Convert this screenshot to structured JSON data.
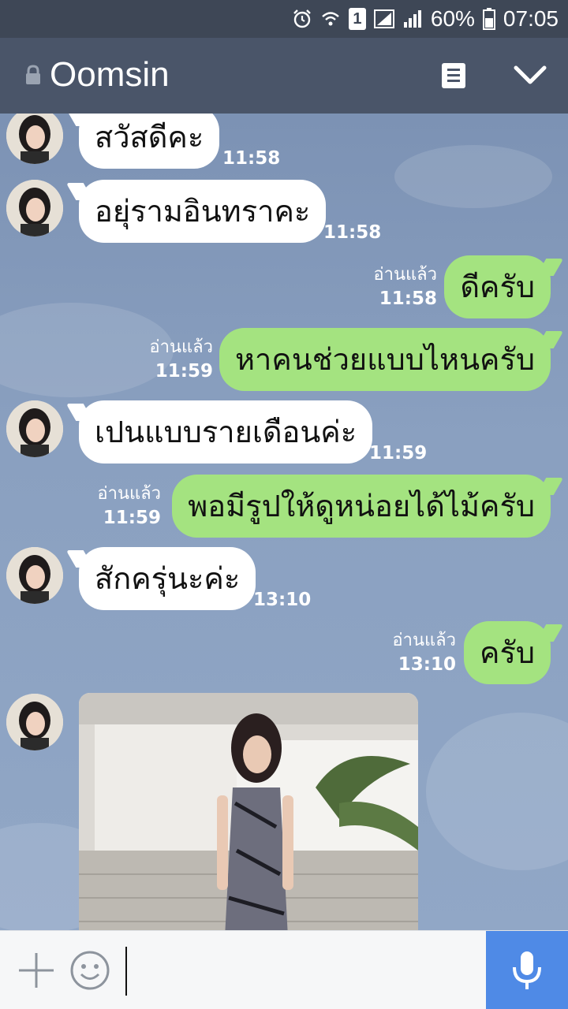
{
  "status_bar": {
    "battery": "60%",
    "time": "07:05",
    "sim_slot": "1",
    "icons": [
      "alarm-icon",
      "wifi-icon",
      "sim-icon",
      "signal-icon",
      "battery-icon"
    ]
  },
  "header": {
    "title": "Oomsin",
    "icons": [
      "lock-icon",
      "notes-icon",
      "chevron-down-icon"
    ]
  },
  "messages": [
    {
      "side": "in",
      "text": "สวัสดีคะ",
      "time": "11:58"
    },
    {
      "side": "in",
      "text": "อยุ่รามอินทราคะ",
      "time": "11:58"
    },
    {
      "side": "out",
      "text": "ดีครับ",
      "read": "อ่านแล้ว",
      "time": "11:58"
    },
    {
      "side": "out",
      "text": "หาคนช่วยแบบไหนครับ",
      "read": "อ่านแล้ว",
      "time": "11:59"
    },
    {
      "side": "in",
      "text": "เปนแบบรายเดือนค่ะ",
      "time": "11:59"
    },
    {
      "side": "out",
      "text": "พอมีรูปให้ดูหน่อยได้ไม้ครับ",
      "read": "อ่านแล้ว",
      "time": "11:59"
    },
    {
      "side": "in",
      "text": "สักครุ่นะค่ะ",
      "time": "13:10"
    },
    {
      "side": "out",
      "text": "ครับ",
      "read": "อ่านแล้ว",
      "time": "13:10"
    },
    {
      "side": "in",
      "type": "photo"
    }
  ],
  "input_bar": {
    "value": "",
    "icons": [
      "plus-icon",
      "emoji-icon",
      "microphone-icon"
    ]
  },
  "colors": {
    "header": "#4a5569",
    "status_bar": "#3e4756",
    "chat_bg": "#7f95b6",
    "incoming_bubble": "#ffffff",
    "outgoing_bubble": "#a4e380",
    "mic_button": "#4f8ae6"
  }
}
